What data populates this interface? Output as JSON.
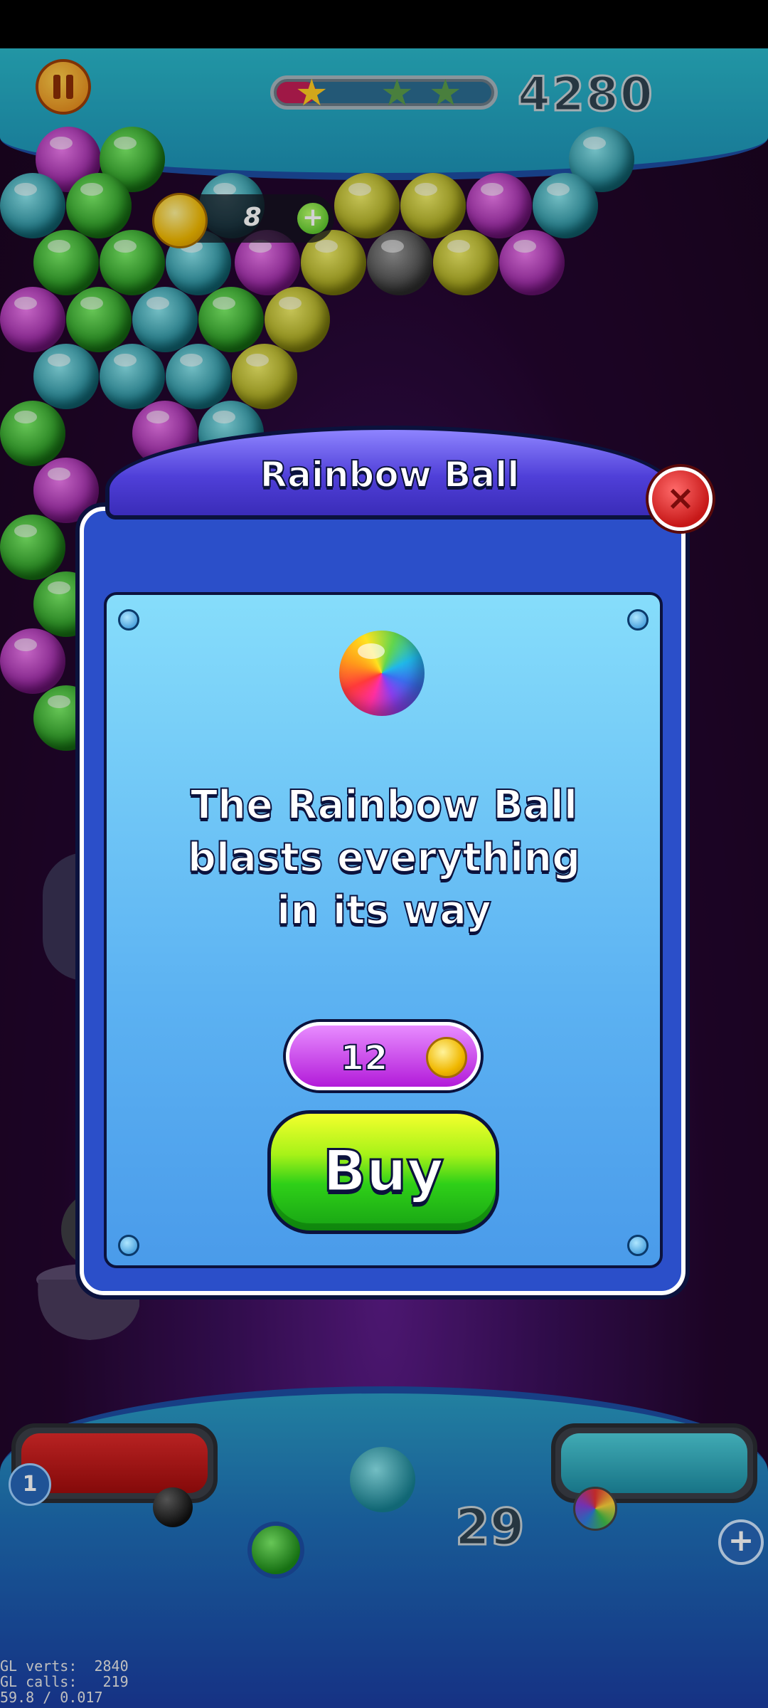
{
  "hud": {
    "score": "4280",
    "stars_earned": 1,
    "stars_total": 3,
    "score_progress": 0.18,
    "coins": "8",
    "pause_icon": "pause-icon"
  },
  "bottom": {
    "bomb_count": "1",
    "shots_left": "29"
  },
  "modal": {
    "title": "Rainbow Ball",
    "description_line1": "The Rainbow Ball",
    "description_line2": "blasts everything",
    "description_line3": "in its way",
    "price": "12",
    "buy_label": "Buy",
    "close_symbol": "×"
  },
  "debug": {
    "gl_verts": "GL verts:  2840",
    "gl_calls": "GL calls:   219",
    "fps": "59.8 / 0.017"
  },
  "colors": {
    "modal_blue": "#2b4fc9",
    "buy_green": "#2fd018",
    "price_purple": "#b21bd9",
    "close_red": "#c71818"
  }
}
